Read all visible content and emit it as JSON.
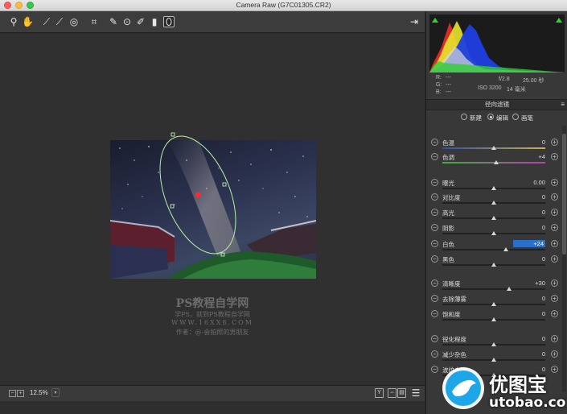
{
  "window": {
    "title": "Camera Raw (G7C01305.CR2)"
  },
  "colors": {
    "accent": "#2a6fc9",
    "mask": "#b6f3a1",
    "pin": "#ff2a2a"
  },
  "toolbar": {
    "tools": [
      "zoom-icon",
      "hand-icon",
      "white-balance-icon",
      "color-sampler-icon",
      "targeted-adjustment-icon",
      "crop-icon",
      "spot-removal-icon",
      "red-eye-icon",
      "adjustment-brush-icon",
      "graduated-filter-icon",
      "radial-filter-icon"
    ],
    "open_prefs_icon": "export-icon"
  },
  "watermark": {
    "line1": "PS教程自学网",
    "line2": "学PS，就到PS教程自学网",
    "line3": "WWW.16XX8.COM",
    "line4": "作者：@-会拍照的男朋友"
  },
  "bottom": {
    "zoom": "12.5%",
    "view_buttons": [
      "Y",
      "⇔",
      "▤"
    ]
  },
  "histogram": {
    "r_label": "R:",
    "g_label": "G:",
    "b_label": "B:",
    "r_val": "---",
    "g_val": "---",
    "b_val": "---",
    "aperture": "f/2.8",
    "shutter": "25.00 秒",
    "iso": "ISO 3200",
    "focal": "14 毫米"
  },
  "panel": {
    "title": "径向滤镜",
    "modes": [
      "新建",
      "编辑",
      "画笔"
    ],
    "selected_mode": "编辑"
  },
  "sliders": [
    {
      "label": "色温",
      "value": "0",
      "pos": 0.5
    },
    {
      "label": "色调",
      "value": "+4",
      "pos": 0.52
    },
    {
      "label": "曝光",
      "value": "0.00",
      "pos": 0.5
    },
    {
      "label": "对比度",
      "value": "0",
      "pos": 0.5
    },
    {
      "label": "高光",
      "value": "0",
      "pos": 0.5
    },
    {
      "label": "阴影",
      "value": "0",
      "pos": 0.5
    },
    {
      "label": "白色",
      "value": "+24",
      "pos": 0.62,
      "selected": true
    },
    {
      "label": "黑色",
      "value": "0",
      "pos": 0.5
    },
    {
      "label": "清晰度",
      "value": "+30",
      "pos": 0.65
    },
    {
      "label": "去除薄雾",
      "value": "0",
      "pos": 0.5
    },
    {
      "label": "饱和度",
      "value": "0",
      "pos": 0.5
    },
    {
      "label": "锐化程度",
      "value": "0",
      "pos": 0.5
    },
    {
      "label": "减少杂色",
      "value": "0",
      "pos": 0.5
    },
    {
      "label": "波纹去除",
      "value": "0",
      "pos": 0.5
    }
  ],
  "logo": {
    "name": "优图宝",
    "url_text": "utobao.com"
  }
}
